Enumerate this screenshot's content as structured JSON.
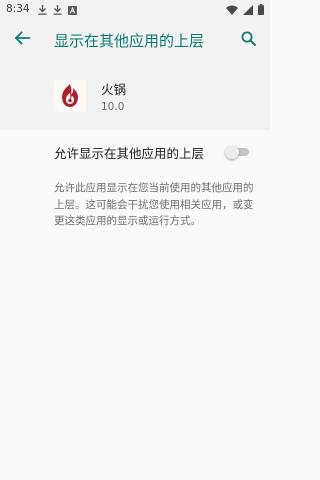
{
  "status_bar": {
    "time": "8:34",
    "left_icons": [
      "download-icon",
      "download-icon",
      "app-notification-icon"
    ],
    "right_icons": [
      "wifi-icon",
      "signal-icon",
      "battery-icon"
    ]
  },
  "app_bar": {
    "title": "显示在其他应用的上层",
    "back_icon": "arrow-back-icon",
    "search_icon": "search-icon"
  },
  "app_info": {
    "name": "火锅",
    "version": "10.0"
  },
  "setting": {
    "label": "允许显示在其他应用的上层",
    "enabled": false
  },
  "description": "允许此应用显示在您当前使用的其他应用的上层。这可能会干扰您使用相关应用，或变更这类应用的显示或运行方式。",
  "colors": {
    "accent": "#0a7d6f",
    "icon_red": "#b0202a"
  }
}
